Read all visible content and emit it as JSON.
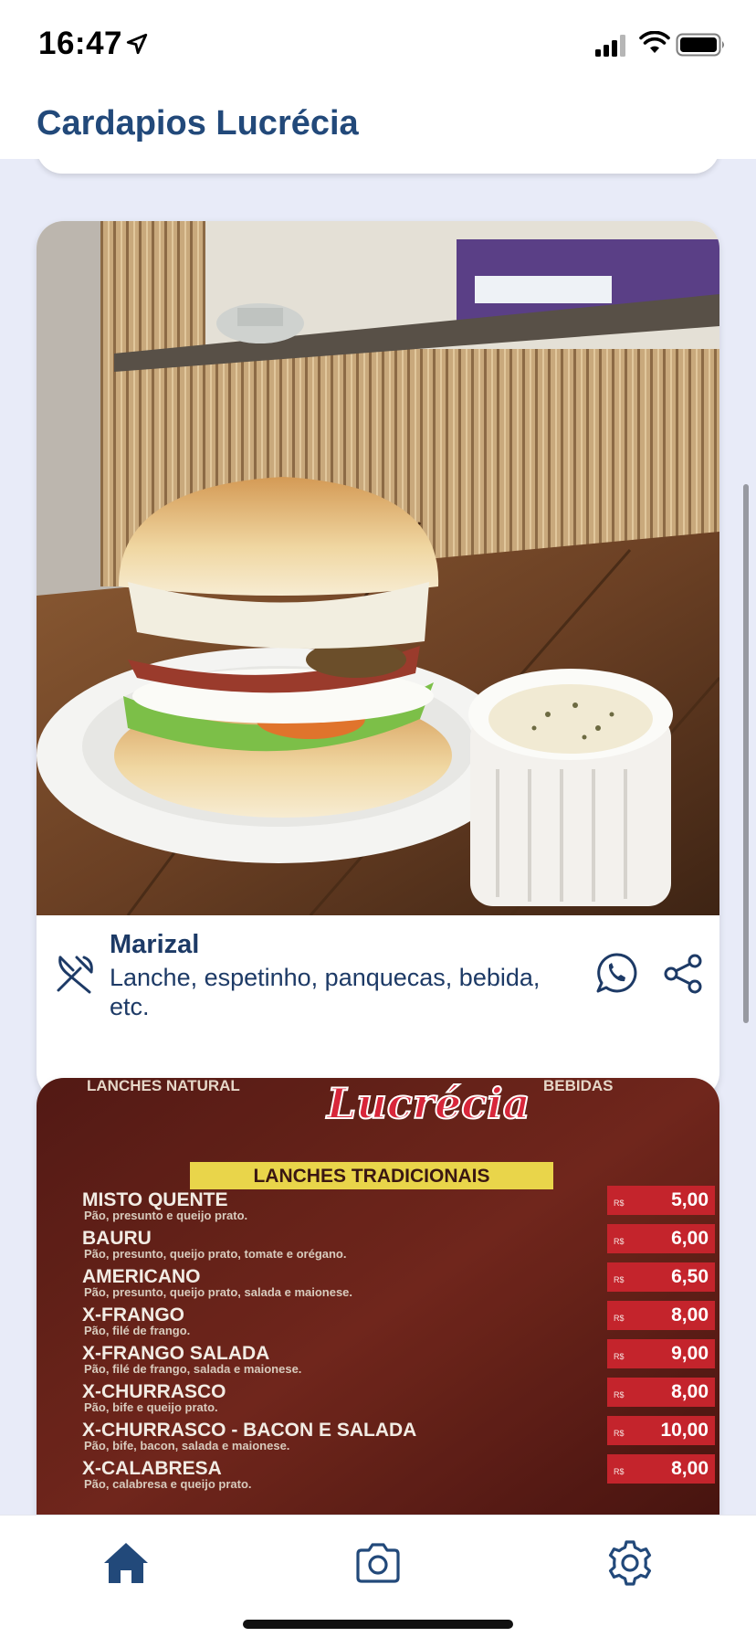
{
  "status_bar": {
    "time": "16:47"
  },
  "header": {
    "title": "Cardapios Lucrécia"
  },
  "cards": [
    {
      "name": "Marizal",
      "description": "Lanche, espetinho, panquecas, bebida, etc.",
      "icon": "cutlery-icon",
      "actions": [
        "whatsapp-icon",
        "share-icon"
      ]
    },
    {
      "menu_image": {
        "brand": "Lucrécia",
        "top_labels": [
          "LANCHES NATURAL",
          "BEBIDAS"
        ],
        "section": "LANCHES TRADICIONAIS",
        "items": [
          {
            "name": "MISTO QUENTE",
            "desc": "Pão, presunto e queijo prato.",
            "price": "5,00"
          },
          {
            "name": "BAURU",
            "desc": "Pão, presunto, queijo prato, tomate e orégano.",
            "price": "6,00"
          },
          {
            "name": "AMERICANO",
            "desc": "Pão, presunto, queijo prato, salada e maionese.",
            "price": "6,50"
          },
          {
            "name": "X-FRANGO",
            "desc": "Pão, filé de frango.",
            "price": "8,00"
          },
          {
            "name": "X-FRANGO SALADA",
            "desc": "Pão, filé de frango, salada e maionese.",
            "price": "9,00"
          },
          {
            "name": "X-CHURRASCO",
            "desc": "Pão, bife e queijo prato.",
            "price": "8,00"
          },
          {
            "name": "X-CHURRASCO - BACON E SALADA",
            "desc": "Pão, bife, bacon, salada e maionese.",
            "price": "10,00"
          },
          {
            "name": "X-CALABRESA",
            "desc": "Pão, calabresa e queijo prato.",
            "price": "8,00"
          }
        ],
        "currency": "R$"
      }
    }
  ],
  "tab_bar": {
    "tabs": [
      "home-icon",
      "camera-icon",
      "gear-icon"
    ],
    "active": "home-icon"
  },
  "colors": {
    "primary": "#22497a",
    "background": "#e8ebf8",
    "card": "#ffffff"
  }
}
